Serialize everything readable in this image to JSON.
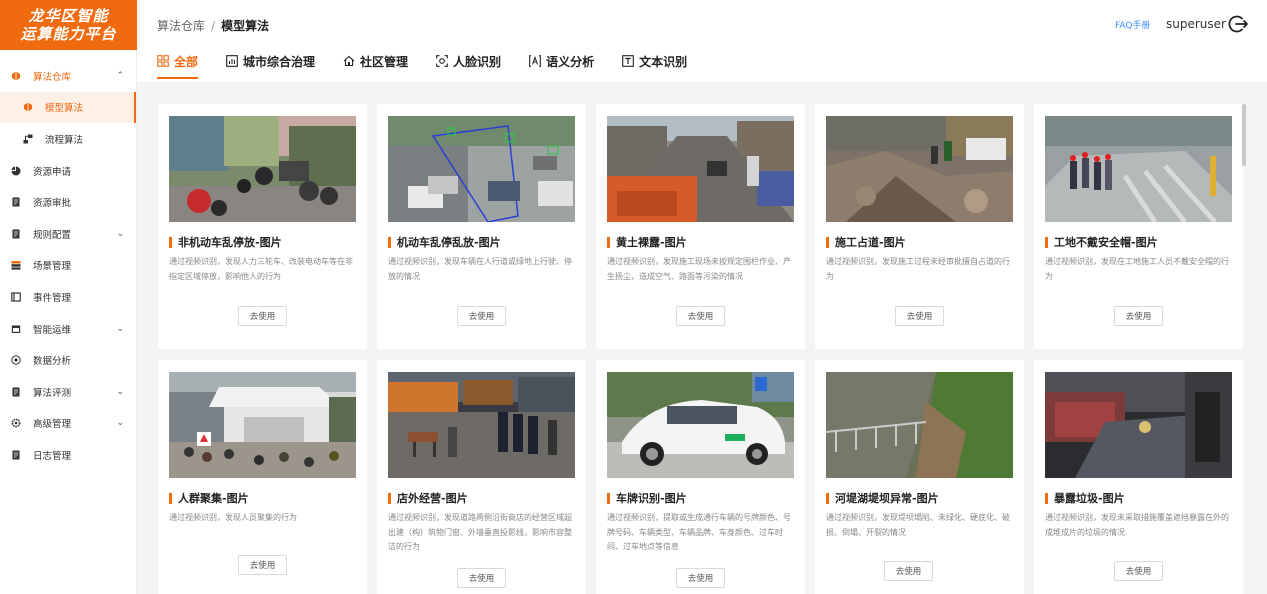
{
  "app": {
    "logo_line1": "龙华区智能",
    "logo_line2": "运算能力平台"
  },
  "sidebar": {
    "items": [
      {
        "label": "算法仓库",
        "icon": "cube-icon",
        "expand": "⌃"
      },
      {
        "label": "模型算法",
        "icon": "cube-icon"
      },
      {
        "label": "流程算法",
        "icon": "flow-icon"
      },
      {
        "label": "资源申请",
        "icon": "pie-icon"
      },
      {
        "label": "资源审批",
        "icon": "doc-icon"
      },
      {
        "label": "规则配置",
        "icon": "doc-icon",
        "expand": "⌄"
      },
      {
        "label": "场景管理",
        "icon": "layers-icon"
      },
      {
        "label": "事件管理",
        "icon": "book-icon"
      },
      {
        "label": "智能运维",
        "icon": "calendar-icon",
        "expand": "⌄"
      },
      {
        "label": "数据分析",
        "icon": "target-icon"
      },
      {
        "label": "算法评测",
        "icon": "doc-icon",
        "expand": "⌄"
      },
      {
        "label": "高级管理",
        "icon": "gear-icon",
        "expand": "⌄"
      },
      {
        "label": "日志管理",
        "icon": "doc-icon"
      }
    ]
  },
  "header": {
    "breadcrumb_root": "算法仓库",
    "breadcrumb_sep": "/",
    "breadcrumb_current": "模型算法",
    "faq": "FAQ手册",
    "user": "superuser"
  },
  "tabs": [
    {
      "label": "全部",
      "icon": "grid-icon"
    },
    {
      "label": "城市综合治理",
      "icon": "chart-icon"
    },
    {
      "label": "社区管理",
      "icon": "home-icon"
    },
    {
      "label": "人脸识别",
      "icon": "face-scan-icon"
    },
    {
      "label": "语义分析",
      "icon": "text-a-icon"
    },
    {
      "label": "文本识别",
      "icon": "text-t-icon"
    }
  ],
  "cards": [
    {
      "title": "非机动车乱停放-图片",
      "desc": "通过视频识别，发现人力三轮车、改装电动车等在非指定区域停放，影响他人的行为",
      "button": "去使用"
    },
    {
      "title": "机动车乱停乱放-图片",
      "desc": "通过视频识别，发现车辆在人行道或绿地上行驶、停放的情况",
      "button": "去使用"
    },
    {
      "title": "黄土裸露-图片",
      "desc": "通过视频识别，发现施工现场未按规定围栏作业、产生扬尘，造成空气、路面等污染的情况",
      "button": "去使用"
    },
    {
      "title": "施工占道-图片",
      "desc": "通过视频识别，发现施工过程未经审批擅自占道的行为",
      "button": "去使用"
    },
    {
      "title": "工地不戴安全帽-图片",
      "desc": "通过视频识别，发现在工地施工人员不戴安全帽的行为",
      "button": "去使用"
    },
    {
      "title": "人群聚集-图片",
      "desc": "通过视频识别，发现人员聚集的行为",
      "button": "去使用"
    },
    {
      "title": "店外经营-图片",
      "desc": "通过视频识别，发现道路两侧沿街商店的经营区域超出建（构）筑物门窗、外墙垂直投影线，影响市容整洁的行为",
      "button": "去使用"
    },
    {
      "title": "车牌识别-图片",
      "desc": "通过视频识别，提取或生成通行车辆的号牌颜色、号牌号码、车辆类型、车辆品牌、车身颜色、过车时间、过车地点等信息",
      "button": "去使用"
    },
    {
      "title": "河堤湖堤坝异常-图片",
      "desc": "通过视频识别，发现堤坝塌陷、未绿化、硬底化、破损、倒塌、开裂的情况",
      "button": "去使用"
    },
    {
      "title": "暴露垃圾-图片",
      "desc": "通过视频识别，发现未采取措施覆盖遮挡暴露在外的成堆成片的垃圾的情况",
      "button": "去使用"
    }
  ],
  "colors": {
    "accent": "#f06a0f",
    "link": "#3f8cff"
  }
}
